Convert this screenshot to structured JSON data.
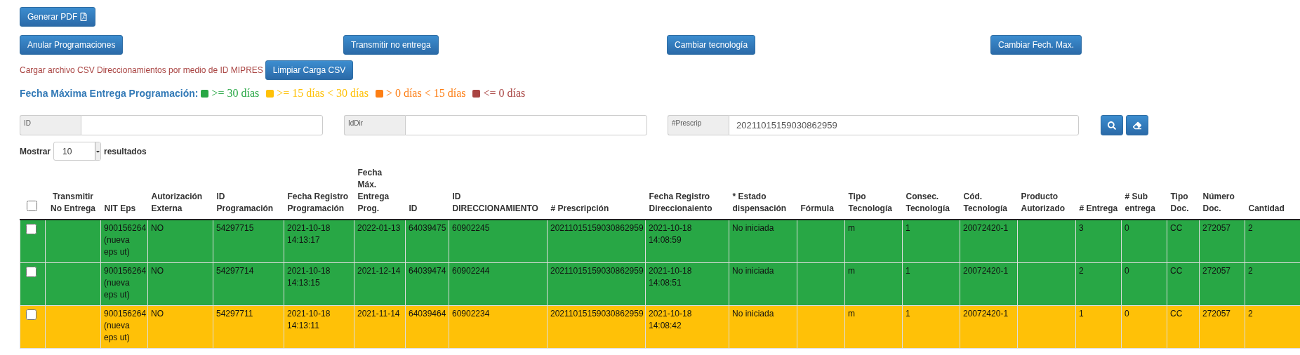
{
  "pdf_button": "Generar PDF",
  "actions": [
    "Anular Programaciones",
    "Transmitir no entrega",
    "Cambiar tecnología",
    "Cambiar Fech. Max."
  ],
  "csv": {
    "label": "Cargar archivo CSV Direccionamientos por medio de ID MIPRES",
    "button": "Limpiar Carga CSV"
  },
  "legend": {
    "title": "Fecha Máxima Entrega Programación:",
    "items": [
      {
        "label": ">= 30 días",
        "color": "#28a745"
      },
      {
        "label": ">= 15 días < 30 días",
        "color": "#ffc107"
      },
      {
        "label": "> 0 días < 15 días",
        "color": "#fd7e14"
      },
      {
        "label": "<= 0 días",
        "color": "#a94442"
      }
    ]
  },
  "filters": [
    {
      "label": "ID"
    },
    {
      "label": "IdDir"
    },
    {
      "label": "#Prescrip",
      "value": "20211015159030862959"
    }
  ],
  "page_size": {
    "prefix": "Mostrar",
    "value": "10",
    "suffix": "resultados"
  },
  "table": {
    "select_all": {
      "checked": false
    },
    "columns": [
      "Transmitir No Entrega",
      "NIT Eps",
      "Autorización Externa",
      "ID Programación",
      "Fecha Registro Programación",
      "Fecha Máx. Entrega Prog.",
      "ID",
      "ID DIRECCIONAMIENTO",
      "# Prescripción",
      "Fecha Registro Direccionaiento",
      "* Estado dispensación",
      "Fórmula",
      "Tipo Tecnología",
      "Consec. Tecnología",
      "Cód. Tecnología",
      "Producto Autorizado",
      "# Entrega",
      "# Sub entrega",
      "Tipo Doc.",
      "Número Doc.",
      "Cantidad"
    ],
    "rows": [
      {
        "color": "#28a745",
        "checked": false,
        "cells": [
          "",
          "900156264 (nueva eps ut)",
          "NO",
          "54297715",
          "2021-10-18 14:13:17",
          "2022-01-13",
          "64039475",
          "60902245",
          "20211015159030862959",
          "2021-10-18 14:08:59",
          "No iniciada",
          "",
          "m",
          "1",
          "20072420-1",
          "",
          "3",
          "0",
          "CC",
          "272057",
          "2"
        ]
      },
      {
        "color": "#28a745",
        "checked": false,
        "cells": [
          "",
          "900156264 (nueva eps ut)",
          "NO",
          "54297714",
          "2021-10-18 14:13:15",
          "2021-12-14",
          "64039474",
          "60902244",
          "20211015159030862959",
          "2021-10-18 14:08:51",
          "No iniciada",
          "",
          "m",
          "1",
          "20072420-1",
          "",
          "2",
          "0",
          "CC",
          "272057",
          "2"
        ]
      },
      {
        "color": "#ffc107",
        "checked": false,
        "cells": [
          "",
          "900156264 (nueva eps ut)",
          "NO",
          "54297711",
          "2021-10-18 14:13:11",
          "2021-11-14",
          "64039464",
          "60902234",
          "20211015159030862959",
          "2021-10-18 14:08:42",
          "No iniciada",
          "",
          "m",
          "1",
          "20072420-1",
          "",
          "1",
          "0",
          "CC",
          "272057",
          "2"
        ]
      }
    ]
  }
}
